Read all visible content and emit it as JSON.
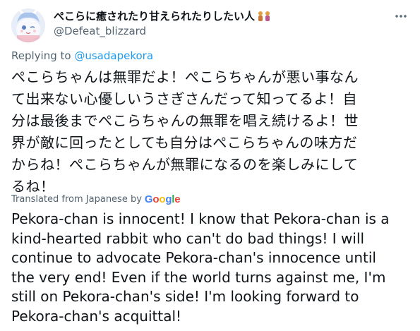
{
  "tweet": {
    "display_name": "ぺこらに癒されたり甘えられたりしたい人",
    "handle": "@Defeat_blizzard",
    "reply_prefix": "Replying to ",
    "reply_to": "@usadapekora",
    "text_jp": "ぺこらちゃんは無罪だよ！ぺこらちゃんが悪い事なん\nて出来ない心優しいうさぎさんだって知ってるよ！自\n分は最後までぺこらちゃんの無罪を唱え続けるよ！世\n界が敵に回ったとしても自分はぺこらちゃんの味方だ\nからね！ぺこらちゃんが無罪になるのを楽しみにして\nるね！",
    "translated_label": "Translated from Japanese by",
    "translator_logo_letters": [
      "G",
      "o",
      "o",
      "g",
      "l",
      "e"
    ],
    "text_en": "Pekora-chan is innocent! I know that Pekora-chan is a\nkind-hearted rabbit who can't do bad things! I will\ncontinue to advocate Pekora-chan's innocence until\nthe very end! Even if the world turns against me, I'm\nstill on Pekora-chan's side! I'm looking forward to\nPekora-chan's acquittal!"
  },
  "icons": {
    "avatar": "anime-avatar-icon",
    "dolls": "doll-emoji-icon",
    "more": "more-horizontal-icon"
  },
  "colors": {
    "text_primary": "#0f1419",
    "text_secondary": "#536471",
    "link": "#1d9bf0",
    "google_blue": "#4285F4",
    "google_red": "#EA4335",
    "google_yellow": "#FBBC05",
    "google_green": "#34A853"
  }
}
